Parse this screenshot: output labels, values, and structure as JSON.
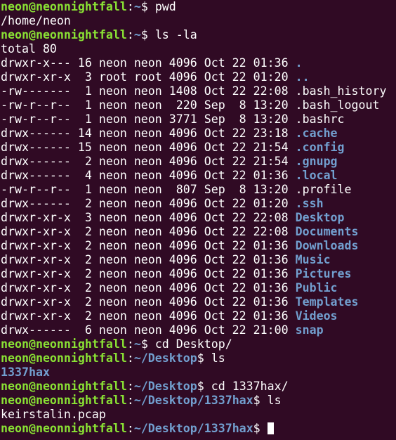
{
  "prompt_user": "neon@neonnightfall",
  "lines": [
    {
      "type": "prompt",
      "path": "~",
      "cmd": "pwd"
    },
    {
      "type": "out",
      "text": "/home/neon"
    },
    {
      "type": "prompt",
      "path": "~",
      "cmd": "ls -la"
    },
    {
      "type": "out",
      "text": "total 80"
    },
    {
      "type": "ls",
      "meta": "drwxr-x--- 16 neon neon 4096 Oct 22 01:36",
      "name": ".",
      "is_dir": true
    },
    {
      "type": "ls",
      "meta": "drwxr-xr-x  3 root root 4096 Oct 22 01:20",
      "name": "..",
      "is_dir": true
    },
    {
      "type": "ls",
      "meta": "-rw-------  1 neon neon 1408 Oct 22 22:08",
      "name": ".bash_history",
      "is_dir": false
    },
    {
      "type": "ls",
      "meta": "-rw-r--r--  1 neon neon  220 Sep  8 13:20",
      "name": ".bash_logout",
      "is_dir": false
    },
    {
      "type": "ls",
      "meta": "-rw-r--r--  1 neon neon 3771 Sep  8 13:20",
      "name": ".bashrc",
      "is_dir": false
    },
    {
      "type": "ls",
      "meta": "drwx------ 14 neon neon 4096 Oct 22 23:18",
      "name": ".cache",
      "is_dir": true
    },
    {
      "type": "ls",
      "meta": "drwx------ 15 neon neon 4096 Oct 22 21:54",
      "name": ".config",
      "is_dir": true
    },
    {
      "type": "ls",
      "meta": "drwx------  2 neon neon 4096 Oct 22 21:54",
      "name": ".gnupg",
      "is_dir": true
    },
    {
      "type": "ls",
      "meta": "drwx------  4 neon neon 4096 Oct 22 01:36",
      "name": ".local",
      "is_dir": true
    },
    {
      "type": "ls",
      "meta": "-rw-r--r--  1 neon neon  807 Sep  8 13:20",
      "name": ".profile",
      "is_dir": false
    },
    {
      "type": "ls",
      "meta": "drwx------  2 neon neon 4096 Oct 22 01:20",
      "name": ".ssh",
      "is_dir": true
    },
    {
      "type": "ls",
      "meta": "drwxr-xr-x  3 neon neon 4096 Oct 22 22:08",
      "name": "Desktop",
      "is_dir": true
    },
    {
      "type": "ls",
      "meta": "drwxr-xr-x  2 neon neon 4096 Oct 22 22:08",
      "name": "Documents",
      "is_dir": true
    },
    {
      "type": "ls",
      "meta": "drwxr-xr-x  2 neon neon 4096 Oct 22 01:36",
      "name": "Downloads",
      "is_dir": true
    },
    {
      "type": "ls",
      "meta": "drwxr-xr-x  2 neon neon 4096 Oct 22 01:36",
      "name": "Music",
      "is_dir": true
    },
    {
      "type": "ls",
      "meta": "drwxr-xr-x  2 neon neon 4096 Oct 22 01:36",
      "name": "Pictures",
      "is_dir": true
    },
    {
      "type": "ls",
      "meta": "drwxr-xr-x  2 neon neon 4096 Oct 22 01:36",
      "name": "Public",
      "is_dir": true
    },
    {
      "type": "ls",
      "meta": "drwxr-xr-x  2 neon neon 4096 Oct 22 01:36",
      "name": "Templates",
      "is_dir": true
    },
    {
      "type": "ls",
      "meta": "drwxr-xr-x  2 neon neon 4096 Oct 22 01:36",
      "name": "Videos",
      "is_dir": true
    },
    {
      "type": "ls",
      "meta": "drwx------  6 neon neon 4096 Oct 22 21:00",
      "name": "snap",
      "is_dir": true
    },
    {
      "type": "prompt",
      "path": "~",
      "cmd": "cd Desktop/"
    },
    {
      "type": "prompt",
      "path": "~/Desktop",
      "cmd": "ls"
    },
    {
      "type": "dirout",
      "text": "1337hax"
    },
    {
      "type": "prompt",
      "path": "~/Desktop",
      "cmd": "cd 1337hax/"
    },
    {
      "type": "prompt",
      "path": "~/Desktop/1337hax",
      "cmd": "ls"
    },
    {
      "type": "out",
      "text": "keirstalin.pcap"
    },
    {
      "type": "prompt",
      "path": "~/Desktop/1337hax",
      "cmd": "",
      "cursor": true
    }
  ],
  "colors": {
    "background": "#300a24",
    "user": "#8ae234",
    "path": "#729fcf",
    "directory": "#729fcf",
    "text": "#ffffff"
  }
}
